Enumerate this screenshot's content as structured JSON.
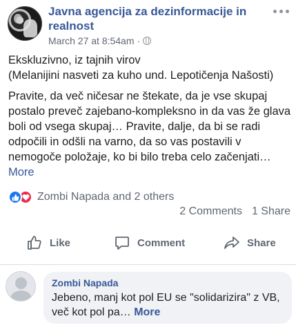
{
  "post": {
    "page_name": "Javna agencija za dezinformacije in realnost",
    "timestamp": "March 27 at 8:54am",
    "separator": "·",
    "body_lines": [
      "Ekskluzivno, iz tajnih virov",
      "(Melanijini nasveti za kuho und. Lepotičenja Našosti)"
    ],
    "body_paragraph": "Pravite, da več ničesar ne štekate, da je vse skupaj postalo preveč zajebano-kompleksno in da vas že glava boli od vsega skupaj… Pravite, dalje, da bi se radi odpočili in odšli na varno, da so vas postavili v nemogoče položaje, ko bi bilo treba celo začenjati…",
    "more_label": "More"
  },
  "reactions": {
    "names": "Zombi Napada and 2 others",
    "comments_count": "2 Comments",
    "shares_count": "1 Share",
    "like_color": "#1877f2",
    "love_color": "#f0284a"
  },
  "actions": {
    "like_label": "Like",
    "comment_label": "Comment",
    "share_label": "Share"
  },
  "comment": {
    "author": "Zombi Napada",
    "text": "Jebeno, manj kot pol EU se \"solidarizira\" z VB, več kot pol pa…",
    "more_label": "More"
  },
  "colors": {
    "link_blue": "#385898",
    "secondary_gray": "#606770"
  }
}
